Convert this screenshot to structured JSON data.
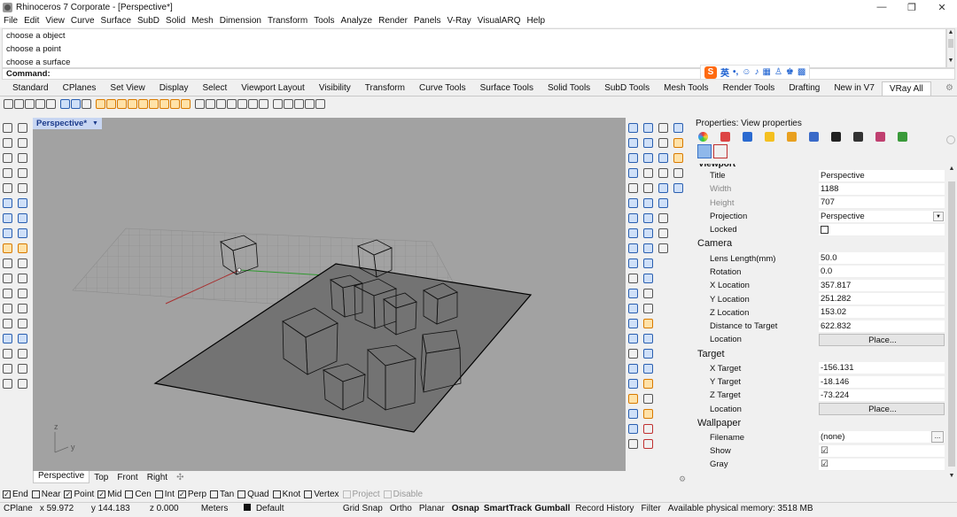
{
  "window": {
    "title": "Rhinoceros 7 Corporate - [Perspective*]",
    "controls": [
      "—",
      "❐",
      "✕"
    ]
  },
  "menu": [
    "File",
    "Edit",
    "View",
    "Curve",
    "Surface",
    "SubD",
    "Solid",
    "Mesh",
    "Dimension",
    "Transform",
    "Tools",
    "Analyze",
    "Render",
    "Panels",
    "V-Ray",
    "VisualARQ",
    "Help"
  ],
  "command_history": [
    "choose a object",
    "choose a point",
    "choose a surface"
  ],
  "command_prompt": "Command:",
  "ime": {
    "logo": "S",
    "mode": "英"
  },
  "toolbar_tabs": [
    "Standard",
    "CPlanes",
    "Set View",
    "Display",
    "Select",
    "Viewport Layout",
    "Visibility",
    "Transform",
    "Curve Tools",
    "Surface Tools",
    "Solid Tools",
    "SubD Tools",
    "Mesh Tools",
    "Render Tools",
    "Drafting",
    "New in V7",
    "VRay All"
  ],
  "active_toolbar_tab": "VRay All",
  "viewport": {
    "label": "Perspective*",
    "tabs": [
      "Perspective",
      "Top",
      "Front",
      "Right"
    ],
    "active_tab": "Perspective",
    "axis_labels": {
      "z": "z",
      "y": "y"
    }
  },
  "properties": {
    "header": "Properties: View properties",
    "viewport_section_clipped": "Viewport",
    "viewport_rows": [
      {
        "key": "Title",
        "value": "Perspective"
      },
      {
        "key": "Width",
        "value": "1188"
      },
      {
        "key": "Height",
        "value": "707"
      },
      {
        "key": "Projection",
        "value": "Perspective"
      },
      {
        "key": "Locked",
        "value": ""
      }
    ],
    "camera_title": "Camera",
    "camera_rows": [
      {
        "key": "Lens Length(mm)",
        "value": "50.0"
      },
      {
        "key": "Rotation",
        "value": "0.0"
      },
      {
        "key": "X Location",
        "value": "357.817"
      },
      {
        "key": "Y Location",
        "value": "251.282"
      },
      {
        "key": "Z Location",
        "value": "153.02"
      },
      {
        "key": "Distance to Target",
        "value": "622.832"
      },
      {
        "key": "Location",
        "value": "Place..."
      }
    ],
    "target_title": "Target",
    "target_rows": [
      {
        "key": "X Target",
        "value": "-156.131"
      },
      {
        "key": "Y Target",
        "value": "-18.146"
      },
      {
        "key": "Z Target",
        "value": "-73.224"
      },
      {
        "key": "Location",
        "value": "Place..."
      }
    ],
    "wallpaper_title": "Wallpaper",
    "wallpaper_rows": [
      {
        "key": "Filename",
        "value": "(none)"
      },
      {
        "key": "Show",
        "value": "☑"
      },
      {
        "key": "Gray",
        "value": "☑"
      }
    ]
  },
  "osnap": [
    {
      "label": "End",
      "checked": true
    },
    {
      "label": "Near",
      "checked": false
    },
    {
      "label": "Point",
      "checked": true
    },
    {
      "label": "Mid",
      "checked": true
    },
    {
      "label": "Cen",
      "checked": false
    },
    {
      "label": "Int",
      "checked": false
    },
    {
      "label": "Perp",
      "checked": true
    },
    {
      "label": "Tan",
      "checked": false
    },
    {
      "label": "Quad",
      "checked": false
    },
    {
      "label": "Knot",
      "checked": false
    },
    {
      "label": "Vertex",
      "checked": false
    },
    {
      "label": "Project",
      "checked": false,
      "disabled": true
    },
    {
      "label": "Disable",
      "checked": false,
      "disabled": true
    }
  ],
  "status": {
    "cplane": "CPlane",
    "x": "x 59.972",
    "y": "y 144.183",
    "z": "z 0.000",
    "units": "Meters",
    "layer": "Default",
    "grid_snap": "Grid Snap",
    "ortho": "Ortho",
    "planar": "Planar",
    "osnap": "Osnap",
    "smarttrack": "SmartTrack",
    "gumball": "Gumball",
    "record_history": "Record History",
    "filter": "Filter",
    "memory": "Available physical memory: 3518 MB"
  }
}
